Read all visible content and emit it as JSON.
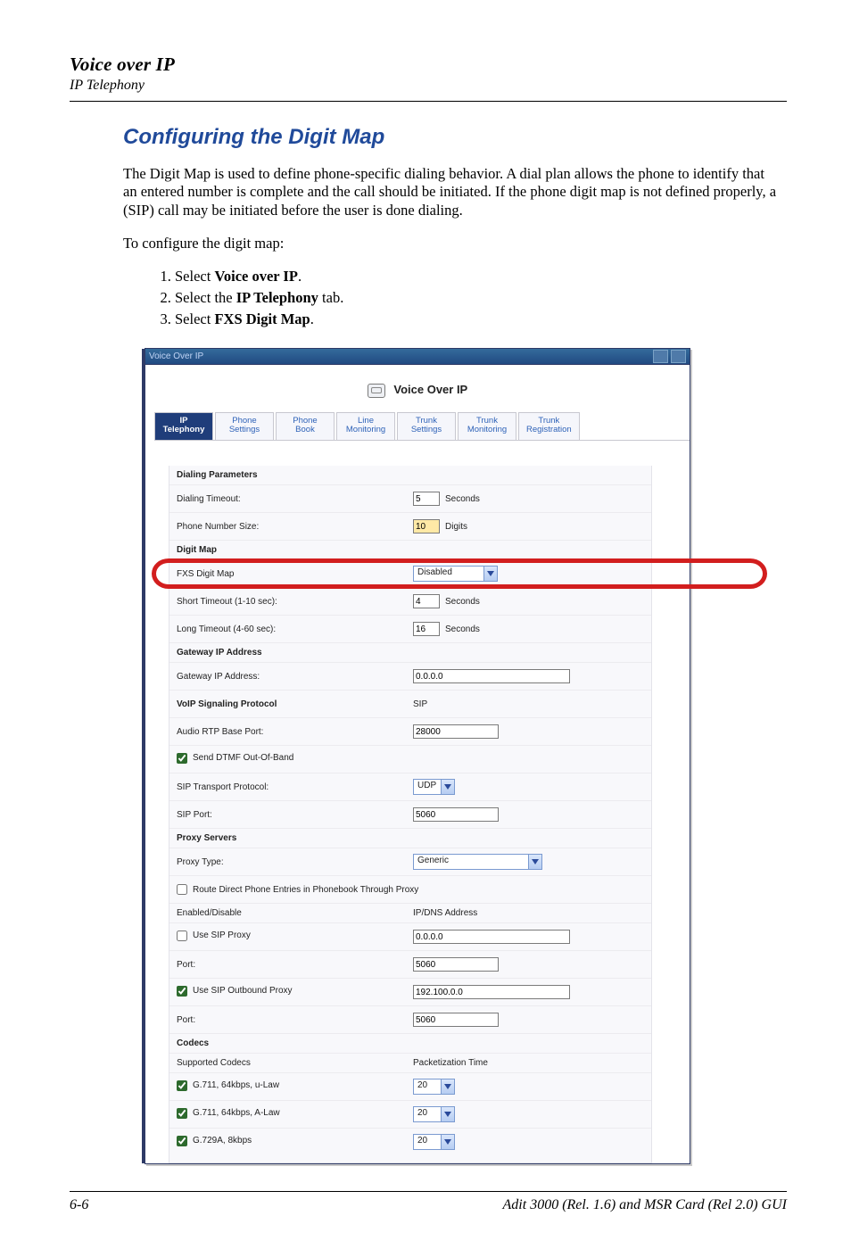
{
  "doc": {
    "header_title": "Voice over IP",
    "header_sub": "IP Telephony",
    "section_title": "Configuring the Digit Map",
    "intro": "The Digit Map is used to define phone-specific dialing behavior. A dial plan allows the phone to identify that an entered number is complete and the call should be initiated. If the phone digit map is not defined properly, a (SIP) call may be initiated before the user is done dialing.",
    "instruction_lead": "To configure the digit map:",
    "steps": {
      "s1a": "Select ",
      "s1b": "Voice over IP",
      "s1c": ".",
      "s2a": "Select the ",
      "s2b": "IP Telephony",
      "s2c": " tab.",
      "s3a": "Select ",
      "s3b": "FXS Digit Map",
      "s3c": "."
    },
    "footer_left": "6-6",
    "footer_right": "Adit 3000 (Rel. 1.6) and MSR Card (Rel 2.0) GUI"
  },
  "app": {
    "window_title": "Voice Over IP",
    "page_title": "Voice Over IP",
    "tabs": [
      {
        "l1": "IP",
        "l2": "Telephony",
        "active": true
      },
      {
        "l1": "Phone",
        "l2": "Settings"
      },
      {
        "l1": "Phone",
        "l2": "Book"
      },
      {
        "l1": "Line",
        "l2": "Monitoring"
      },
      {
        "l1": "Trunk",
        "l2": "Settings"
      },
      {
        "l1": "Trunk",
        "l2": "Monitoring"
      },
      {
        "l1": "Trunk",
        "l2": "Registration"
      }
    ],
    "sections": {
      "dialing": "Dialing Parameters",
      "digitmap": "Digit Map",
      "gateway": "Gateway IP Address",
      "voip": "VoIP Signaling Protocol",
      "proxy": "Proxy Servers",
      "codecs": "Codecs"
    },
    "labels": {
      "dial_timeout": "Dialing Timeout:",
      "phone_size": "Phone Number Size:",
      "fxs_digitmap": "FXS Digit Map",
      "short_timeout": "Short Timeout (1-10 sec):",
      "long_timeout": "Long Timeout (4-60 sec):",
      "gateway_ip": "Gateway IP Address:",
      "sip_proto_value": "SIP",
      "rtp_base_port": "Audio RTP Base Port:",
      "send_dtmf": "Send DTMF Out-Of-Band",
      "sip_transport": "SIP Transport Protocol:",
      "sip_port": "SIP Port:",
      "proxy_type": "Proxy Type:",
      "route_direct": "Route Direct Phone Entries in Phonebook Through Proxy",
      "enable_disable": "Enabled/Disable",
      "ip_dns": "IP/DNS Address",
      "use_sip_proxy": "Use SIP Proxy",
      "port": "Port:",
      "use_outbound": "Use SIP Outbound Proxy",
      "supported_codecs": "Supported Codecs",
      "pkt_time": "Packetization Time",
      "codec_g711u": "G.711, 64kbps, u-Law",
      "codec_g711a": "G.711, 64kbps, A-Law",
      "codec_g729": "G.729A, 8kbps"
    },
    "suffixes": {
      "seconds": "Seconds",
      "digits": "Digits"
    },
    "values": {
      "dial_timeout": "5",
      "phone_size": "10",
      "fxs_digitmap": "Disabled",
      "short_timeout": "4",
      "long_timeout": "16",
      "gateway_ip": "0.0.0.0",
      "rtp_base_port": "28000",
      "sip_transport": "UDP",
      "sip_port": "5060",
      "proxy_type": "Generic",
      "sip_proxy_ip": "0.0.0.0",
      "sip_proxy_port": "5060",
      "outbound_ip": "192.100.0.0",
      "outbound_port": "5060",
      "pkt_g711u": "20",
      "pkt_g711a": "20",
      "pkt_g729": "20"
    },
    "checks": {
      "send_dtmf": true,
      "route_direct": false,
      "use_sip_proxy": false,
      "use_outbound": true,
      "codec_g711u": true,
      "codec_g711a": true,
      "codec_g729": true
    }
  }
}
